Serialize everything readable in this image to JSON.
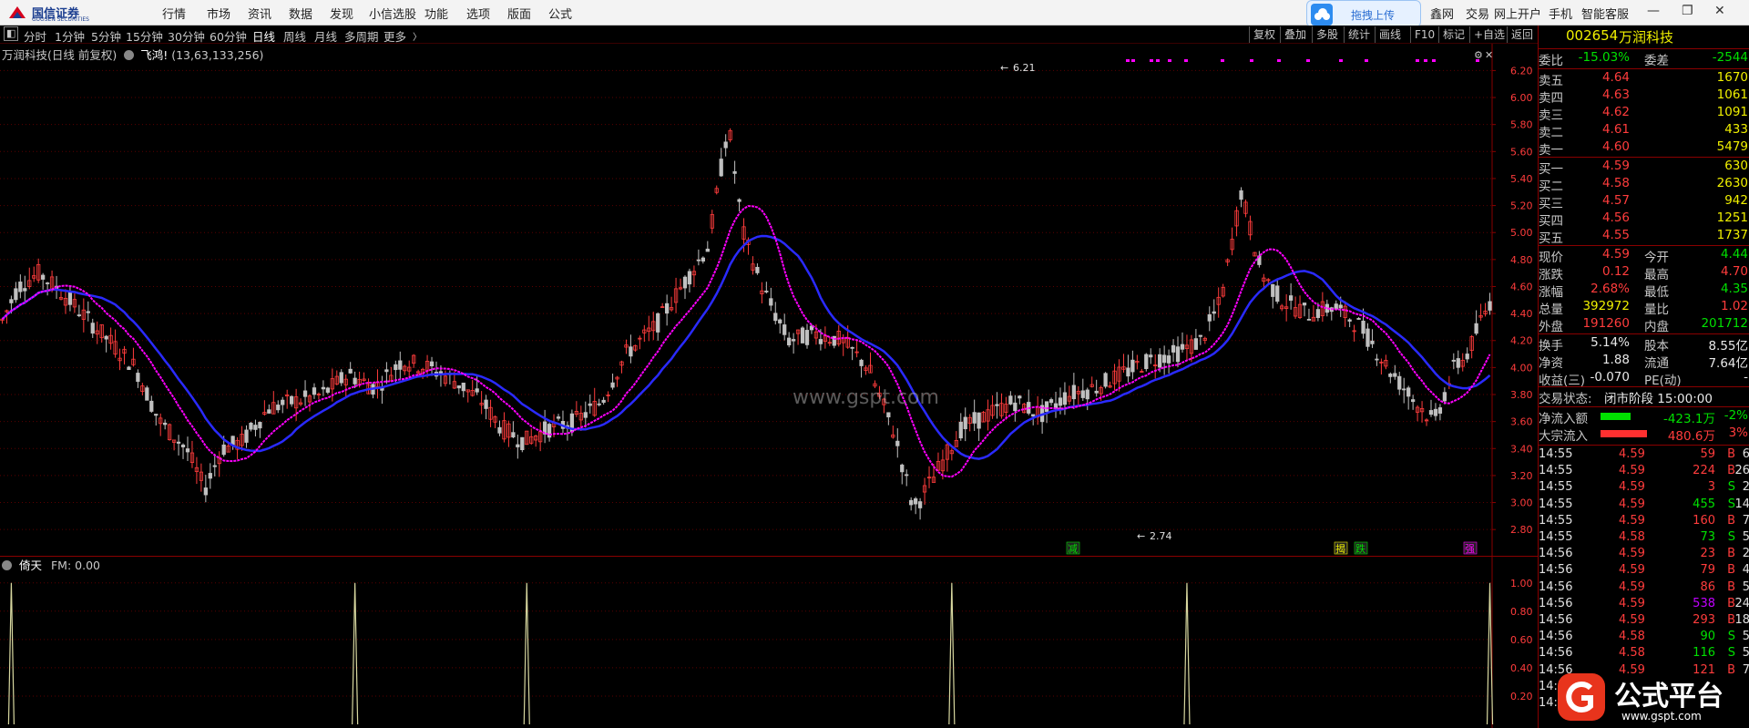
{
  "menubar": {
    "logo_text": "国信证券",
    "logo_sub": "GUOSEN SECURITIES",
    "items": [
      "行情",
      "市场",
      "资讯",
      "数据",
      "发现",
      "小信选股",
      "功能",
      "选项",
      "版面",
      "公式"
    ],
    "upload_label": "拖拽上传",
    "right_items": [
      "鑫网",
      "交易",
      "网上开户",
      "手机",
      "智能客服"
    ]
  },
  "toolbar": {
    "periods": [
      "分时",
      "1分钟",
      "5分钟",
      "15分钟",
      "30分钟",
      "60分钟",
      "日线",
      "周线",
      "月线",
      "多周期",
      "更多"
    ],
    "active_period": "日线",
    "right_buttons": [
      "复权",
      "叠加",
      "多股",
      "统计",
      "画线",
      "F10",
      "标记",
      "+自选",
      "返回"
    ]
  },
  "main_panel": {
    "title": "万润科技(日线 前复权)",
    "indicator": "飞鸿!",
    "params": "(13,63,133,256)",
    "high_label": "6.21",
    "low_label": "2.74",
    "event_labels": [
      "减",
      "揭",
      "跌",
      "强"
    ],
    "watermark": "www.gspt.com"
  },
  "sub_panel": {
    "title": "倚天",
    "params": "FM: 0.00"
  },
  "colors": {
    "up": "#ff3c3c",
    "down": "#c0c0c0",
    "ma_blue": "#2a2aff",
    "ma_magenta": "#ff00ff",
    "grid": "#5a0000",
    "axis_text": "#ff3c3c",
    "spike": "#d8d8a0"
  },
  "chart_data": {
    "type": "candlestick",
    "y_ticks_main": [
      "6.20",
      "6.00",
      "5.80",
      "5.60",
      "5.40",
      "5.20",
      "5.00",
      "4.80",
      "4.60",
      "4.40",
      "4.20",
      "4.00",
      "3.80",
      "3.60",
      "3.40",
      "3.20",
      "3.00",
      "2.80"
    ],
    "ylim_main": [
      2.7,
      6.25
    ],
    "y_ticks_sub": [
      "1.00",
      "0.80",
      "0.60",
      "0.40",
      "0.20"
    ],
    "ylim_sub": [
      0,
      1.05
    ],
    "n_bars": 330,
    "spike_bar_indices": [
      2,
      78,
      116,
      210,
      262,
      329
    ],
    "spike_value": 1.0
  },
  "side": {
    "code": "002654",
    "name": "万润科技",
    "weibi_label": "委比",
    "weibi": "-15.03%",
    "weicha_label": "委差",
    "weicha": "-2544",
    "asks": [
      {
        "label": "卖五",
        "price": "4.64",
        "vol": "1670"
      },
      {
        "label": "卖四",
        "price": "4.63",
        "vol": "1061"
      },
      {
        "label": "卖三",
        "price": "4.62",
        "vol": "1091"
      },
      {
        "label": "卖二",
        "price": "4.61",
        "vol": "433"
      },
      {
        "label": "卖一",
        "price": "4.60",
        "vol": "5479"
      }
    ],
    "bids": [
      {
        "label": "买一",
        "price": "4.59",
        "vol": "630"
      },
      {
        "label": "买二",
        "price": "4.58",
        "vol": "2630"
      },
      {
        "label": "买三",
        "price": "4.57",
        "vol": "942"
      },
      {
        "label": "买四",
        "price": "4.56",
        "vol": "1251"
      },
      {
        "label": "买五",
        "price": "4.55",
        "vol": "1737"
      }
    ],
    "stats": [
      {
        "l1": "现价",
        "v1": "4.59",
        "c1": "red",
        "l2": "今开",
        "v2": "4.44",
        "c2": "green"
      },
      {
        "l1": "涨跌",
        "v1": "0.12",
        "c1": "red",
        "l2": "最高",
        "v2": "4.70",
        "c2": "red"
      },
      {
        "l1": "涨幅",
        "v1": "2.68%",
        "c1": "red",
        "l2": "最低",
        "v2": "4.35",
        "c2": "green"
      },
      {
        "l1": "总量",
        "v1": "392972",
        "c1": "yellow",
        "l2": "量比",
        "v2": "1.02",
        "c2": "red"
      },
      {
        "l1": "外盘",
        "v1": "191260",
        "c1": "red",
        "l2": "内盘",
        "v2": "201712",
        "c2": "green"
      }
    ],
    "stats2": [
      {
        "l1": "换手",
        "v1": "5.14%",
        "l2": "股本",
        "v2": "8.55亿"
      },
      {
        "l1": "净资",
        "v1": "1.88",
        "l2": "流通",
        "v2": "7.64亿"
      },
      {
        "l1": "收益(三)",
        "v1": "-0.070",
        "l2": "PE(动)",
        "v2": "-"
      }
    ],
    "trade_state_label": "交易状态:",
    "trade_state": "闭市阶段 15:00:00",
    "flows": [
      {
        "label": "净流入额",
        "value": "-423.1万",
        "pct": "-2%",
        "color": "green",
        "bar": 0.55
      },
      {
        "label": "大宗流入",
        "value": "480.6万",
        "pct": "3%",
        "color": "red",
        "bar": 0.85
      }
    ],
    "ticks": [
      {
        "t": "14:55",
        "p": "4.59",
        "v": "59",
        "vc": "red",
        "bs": "B",
        "n": "6"
      },
      {
        "t": "14:55",
        "p": "4.59",
        "v": "224",
        "vc": "red",
        "bs": "B",
        "n": "26"
      },
      {
        "t": "14:55",
        "p": "4.59",
        "v": "3",
        "vc": "red",
        "bs": "S",
        "n": "2"
      },
      {
        "t": "14:55",
        "p": "4.59",
        "v": "455",
        "vc": "green",
        "bs": "S",
        "n": "14"
      },
      {
        "t": "14:55",
        "p": "4.59",
        "v": "160",
        "vc": "red",
        "bs": "B",
        "n": "7"
      },
      {
        "t": "14:55",
        "p": "4.58",
        "v": "73",
        "vc": "green",
        "bs": "S",
        "n": "5"
      },
      {
        "t": "14:56",
        "p": "4.59",
        "v": "23",
        "vc": "red",
        "bs": "B",
        "n": "2"
      },
      {
        "t": "14:56",
        "p": "4.59",
        "v": "79",
        "vc": "red",
        "bs": "B",
        "n": "4"
      },
      {
        "t": "14:56",
        "p": "4.59",
        "v": "86",
        "vc": "red",
        "bs": "B",
        "n": "5"
      },
      {
        "t": "14:56",
        "p": "4.59",
        "v": "538",
        "vc": "purple",
        "bs": "B",
        "n": "24"
      },
      {
        "t": "14:56",
        "p": "4.59",
        "v": "293",
        "vc": "red",
        "bs": "B",
        "n": "18"
      },
      {
        "t": "14:56",
        "p": "4.58",
        "v": "90",
        "vc": "green",
        "bs": "S",
        "n": "5"
      },
      {
        "t": "14:56",
        "p": "4.58",
        "v": "116",
        "vc": "green",
        "bs": "S",
        "n": "5"
      },
      {
        "t": "14:56",
        "p": "4.59",
        "v": "121",
        "vc": "red",
        "bs": "B",
        "n": "7"
      },
      {
        "t": "14:5",
        "p": "",
        "v": "",
        "vc": "red",
        "bs": "",
        "n": ""
      },
      {
        "t": "14:5",
        "p": "",
        "v": "",
        "vc": "red",
        "bs": "",
        "n": ""
      }
    ]
  },
  "brand": {
    "title": "公式平台",
    "url": "www.gspt.com"
  }
}
